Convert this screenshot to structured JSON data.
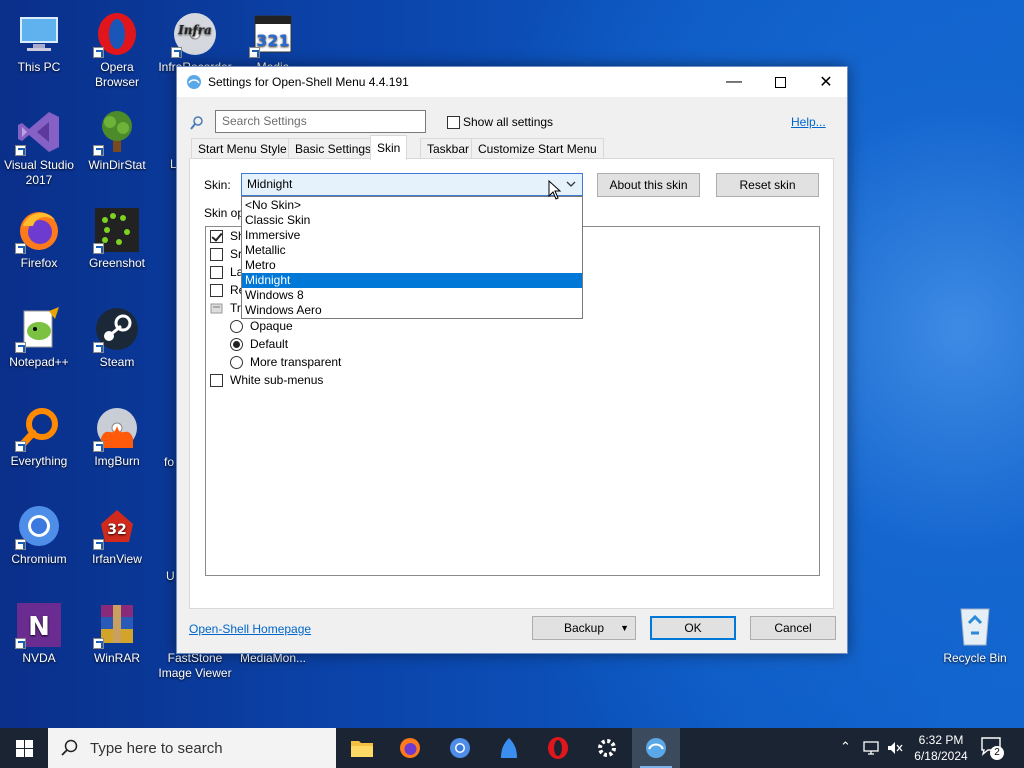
{
  "desktop": {
    "icons": [
      {
        "label": "This PC"
      },
      {
        "label": "Opera Browser"
      },
      {
        "label": "InfraRecorder"
      },
      {
        "label": "Media Player..."
      },
      {
        "label": "Visual Studio 2017"
      },
      {
        "label": "WinDirStat"
      },
      {
        "label": "Firefox"
      },
      {
        "label": "Greenshot"
      },
      {
        "label": "Notepad++"
      },
      {
        "label": "Steam"
      },
      {
        "label": "Everything"
      },
      {
        "label": "ImgBurn"
      },
      {
        "label": "Chromium"
      },
      {
        "label": "IrfanView"
      },
      {
        "label": "NVDA"
      },
      {
        "label": "WinRAR"
      },
      {
        "label": "FastStone Image Viewer"
      },
      {
        "label": "MediaMon..."
      },
      {
        "label": "Recycle Bin"
      }
    ],
    "partial_labels": [
      "L",
      "fo",
      "U"
    ]
  },
  "window": {
    "title": "Settings for Open-Shell Menu 4.4.191",
    "search_placeholder": "Search Settings",
    "show_all_label": "Show all settings",
    "help_link": "Help...",
    "tabs": [
      {
        "label": "Start Menu Style"
      },
      {
        "label": "Basic Settings"
      },
      {
        "label": "Skin",
        "active": true
      },
      {
        "label": "Taskbar"
      },
      {
        "label": "Customize Start Menu"
      }
    ],
    "skin_label": "Skin:",
    "skin_value": "Midnight",
    "about_skin": "About this skin",
    "reset_skin": "Reset skin",
    "skin_options_label": "Skin op",
    "skin_list": [
      "<No Skin>",
      "Classic Skin",
      "Immersive",
      "Metallic",
      "Metro",
      "Midnight",
      "Windows 8",
      "Windows Aero"
    ],
    "selected_skin": "Midnight",
    "options": {
      "row1": {
        "text": "Sh",
        "checked": true
      },
      "row2": {
        "text": "Sr",
        "checked": false
      },
      "row3": {
        "text": "La",
        "checked": false
      },
      "row4": {
        "text": "Re",
        "checked": false
      },
      "row5": {
        "text": "Tra"
      },
      "radio_opaque": "Opaque",
      "radio_default": "Default",
      "radio_more_transparent": "More transparent",
      "selected_radio": "Default",
      "white_submenus": "White sub-menus"
    },
    "homepage_link": "Open-Shell Homepage",
    "backup": "Backup",
    "ok": "OK",
    "cancel": "Cancel"
  },
  "taskbar": {
    "search_placeholder": "Type here to search",
    "time": "6:32 PM",
    "date": "6/18/2024",
    "notification_count": "2"
  },
  "colors": {
    "accent": "#0078d7",
    "link": "#0066cc",
    "taskbar": "#1b2433"
  }
}
